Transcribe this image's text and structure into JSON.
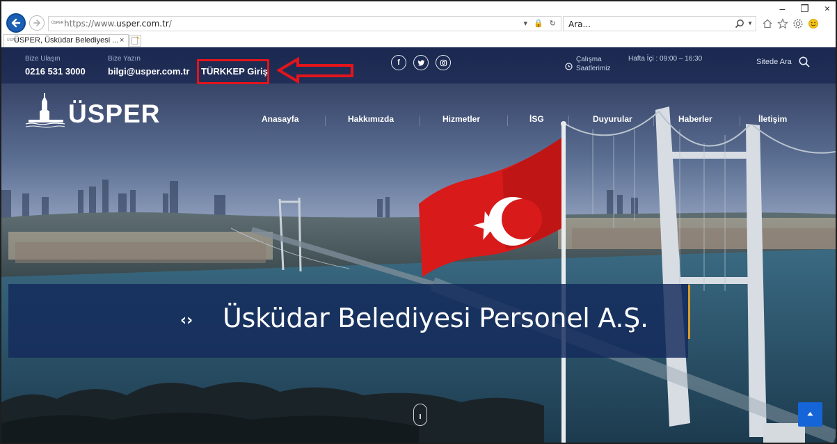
{
  "browser": {
    "url_prefix": "https://www.",
    "url_domain": "usper.com.tr",
    "url_suffix": "/",
    "search_placeholder": "Ara...",
    "tab_title": "ÜSPER, Üsküdar Belediyesi ...",
    "tab_close": "×",
    "favicon_text": "ÜSPER",
    "window_controls": {
      "minimize": "–",
      "restore": "❐",
      "close": "×"
    },
    "address_icons": "▾ 🔒 ↻"
  },
  "topbar": {
    "contact_label": "Bize Ulaşın",
    "phone": "0216 531 3000",
    "write_label": "Bize Yazın",
    "email": "bilgi@usper.com.tr",
    "turkkep_link": "TÜRKKEP Giriş",
    "socials": [
      {
        "icon": "facebook-icon",
        "glyph": "f"
      },
      {
        "icon": "twitter-icon",
        "glyph": "🐦"
      },
      {
        "icon": "instagram-icon",
        "glyph": "◎"
      }
    ],
    "hours_label": "Çalışma Saatlerimiz",
    "hours_value": "Hafta İçi : 09:00 – 16:30",
    "site_search": "Sitede Ara"
  },
  "site": {
    "logo_text": "ÜSPER"
  },
  "nav": {
    "items": [
      "Anasayfa",
      "Hakkımızda",
      "Hizmetler",
      "İSG",
      "Duyurular",
      "Haberler",
      "İletişim"
    ]
  },
  "banner": {
    "icon": "‹›",
    "title": "Üsküdar Belediyesi Personel A.Ş."
  },
  "colors": {
    "annotation_red": "#e2141c",
    "banner_accent": "#d79a2c",
    "to_top_blue": "#1565d8",
    "browser_back_blue": "#1a5fb4"
  }
}
